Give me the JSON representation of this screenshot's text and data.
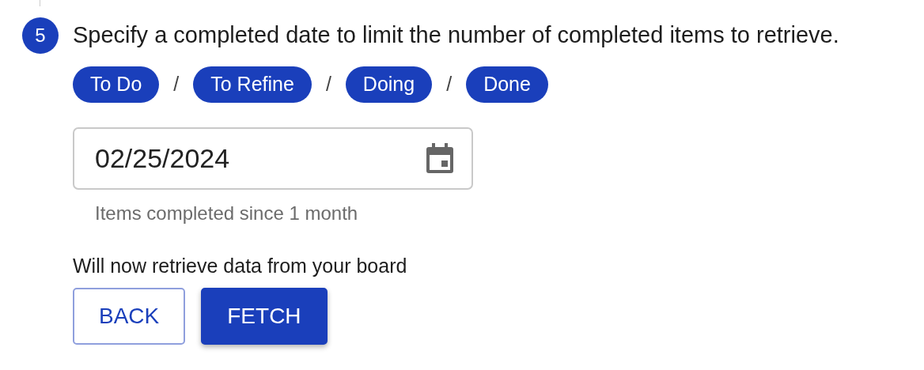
{
  "step": {
    "number": "5",
    "instruction": "Specify a completed date to limit the number of completed items to retrieve."
  },
  "columns": [
    {
      "label": "To Do"
    },
    {
      "label": "To Refine"
    },
    {
      "label": "Doing"
    },
    {
      "label": "Done"
    }
  ],
  "separator": "/",
  "date_field": {
    "value": "02/25/2024",
    "helper": "Items completed since 1 month"
  },
  "message": "Will now retrieve data from your board",
  "buttons": [
    {
      "label": "BACK",
      "kind": "outline"
    },
    {
      "label": "FETCH",
      "kind": "filled"
    }
  ]
}
